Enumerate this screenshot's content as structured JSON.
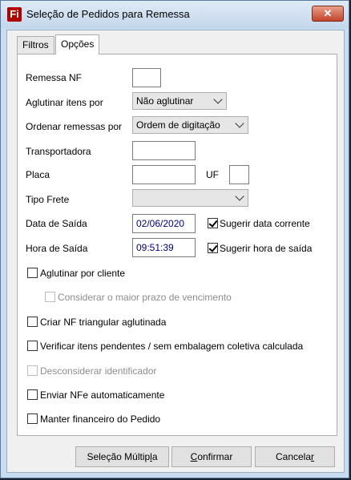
{
  "window": {
    "title": "Seleção de Pedidos para Remessa",
    "close_glyph": "✕",
    "app_icon_glyph": "Fi"
  },
  "tabs": [
    {
      "label": "Filtros",
      "active": false
    },
    {
      "label": "Opções",
      "active": true
    }
  ],
  "form": {
    "remessa_nf": {
      "label": "Remessa NF",
      "value": ""
    },
    "aglutinar_itens": {
      "label": "Aglutinar itens por",
      "value": "Não aglutinar"
    },
    "ordenar_remessas": {
      "label": "Ordenar remessas por",
      "value": "Ordem de digitação"
    },
    "transportadora": {
      "label": "Transportadora",
      "value": ""
    },
    "placa": {
      "label": "Placa",
      "value": ""
    },
    "uf": {
      "label": "UF",
      "value": ""
    },
    "tipo_frete": {
      "label": "Tipo Frete",
      "value": ""
    },
    "data_saida": {
      "label": "Data de Saída",
      "value": "02/06/2020"
    },
    "sugerir_data": {
      "label": "Sugerir data corrente",
      "checked": true
    },
    "hora_saida": {
      "label": "Hora de Saída",
      "value": "09:51:39"
    },
    "sugerir_hora": {
      "label": "Sugerir hora de saída",
      "checked": true
    }
  },
  "options": {
    "aglutinar_cliente": {
      "label": "Aglutinar por cliente",
      "checked": false,
      "enabled": true
    },
    "maior_prazo": {
      "label": "Considerar o maior prazo de vencimento",
      "checked": false,
      "enabled": false
    },
    "nf_triangular": {
      "label": "Criar NF triangular aglutinada",
      "checked": false,
      "enabled": true
    },
    "verificar_itens": {
      "label": "Verificar itens pendentes / sem embalagem coletiva calculada",
      "checked": false,
      "enabled": true
    },
    "desconsiderar_ident": {
      "label": "Desconsiderar identificador",
      "checked": false,
      "enabled": false
    },
    "enviar_nfe": {
      "label": "Enviar NFe automaticamente",
      "checked": false,
      "enabled": true
    },
    "manter_financeiro": {
      "label": "Manter financeiro do Pedido",
      "checked": false,
      "enabled": true
    }
  },
  "buttons": {
    "selecao_multipla": {
      "label_pre": "Seleção Múltip",
      "label_key": "l",
      "label_post": "a"
    },
    "confirmar": {
      "label_pre": "",
      "label_key": "C",
      "label_post": "onfirmar"
    },
    "cancelar": {
      "label_pre": "Cancela",
      "label_key": "r",
      "label_post": ""
    }
  }
}
